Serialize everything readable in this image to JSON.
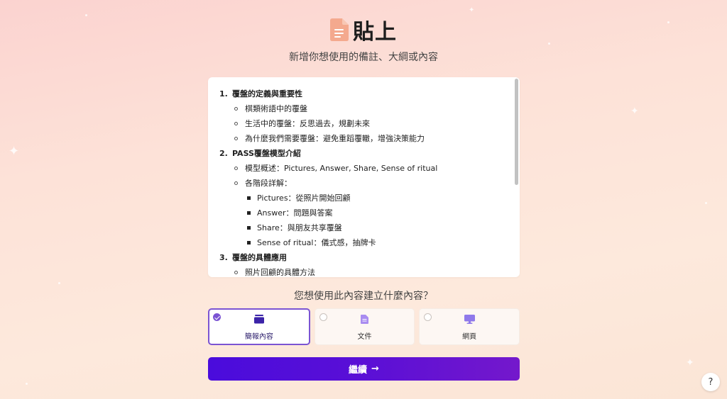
{
  "header": {
    "title": "貼上",
    "subtitle": "新增你想使用的備註、大綱或內容"
  },
  "editor": {
    "lines": [
      {
        "level": 1,
        "num": "1.",
        "text": "覆盤的定義與重要性"
      },
      {
        "level": 2,
        "text": "棋類術語中的覆盤"
      },
      {
        "level": 2,
        "text": "生活中的覆盤：反思過去，規劃未來"
      },
      {
        "level": 2,
        "text": "為什麼我們需要覆盤：避免重蹈覆轍，增強決策能力"
      },
      {
        "level": 1,
        "num": "2.",
        "text": "PASS覆盤模型介紹"
      },
      {
        "level": 2,
        "text": "模型概述：Pictures, Answer, Share, Sense of ritual"
      },
      {
        "level": 2,
        "text": "各階段詳解："
      },
      {
        "level": 3,
        "text": "Pictures：從照片開始回顧"
      },
      {
        "level": 3,
        "text": "Answer：問題與答案"
      },
      {
        "level": 3,
        "text": "Share：與朋友共享覆盤"
      },
      {
        "level": 3,
        "text": "Sense of ritual：儀式感，抽牌卡"
      },
      {
        "level": 1,
        "num": "3.",
        "text": "覆盤的具體應用"
      },
      {
        "level": 2,
        "text": "照片回顧的具體方法"
      }
    ]
  },
  "question": "您想使用此內容建立什麼內容？",
  "options": [
    {
      "label": "簡報內容",
      "icon": "presentation-icon",
      "selected": true
    },
    {
      "label": "文件",
      "icon": "document-icon",
      "selected": false
    },
    {
      "label": "網頁",
      "icon": "monitor-icon",
      "selected": false
    }
  ],
  "continue": {
    "label": "繼續",
    "arrow": "→"
  },
  "help": {
    "label": "?"
  },
  "colors": {
    "accent": "#7b54d3",
    "button_start": "#4a0cdc",
    "button_end": "#7418cc",
    "icon_peach": "#f4a98e"
  }
}
